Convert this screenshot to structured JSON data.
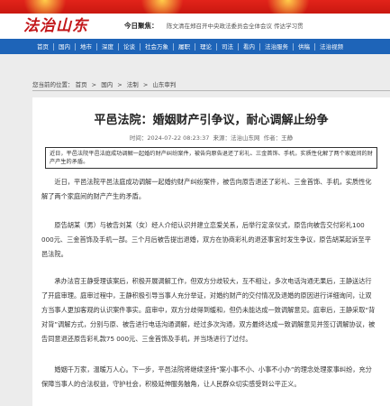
{
  "header": {
    "logo_text": "法治山东",
    "focus_label": "今日聚焦：",
    "focus_text": "陈文清在郑召开中央政法委员会全体会议 传达学习贯"
  },
  "nav": {
    "items": [
      "首页",
      "国内",
      "地市",
      "深度",
      "论谈",
      "社会万象",
      "履职",
      "理论",
      "司法",
      "看内",
      "法治服务",
      "供稿",
      "法治视频"
    ]
  },
  "breadcrumb": {
    "prefix": "您当前的位置：",
    "items": [
      "首页",
      "国内",
      "法制",
      "山东审判"
    ]
  },
  "article": {
    "title": "平邑法院：婚姻财产引争议，耐心调解止纷争",
    "time_label": "时间：",
    "time": "2024-07-22 08:23:37",
    "source_label": "来源：",
    "source": "法治山东网",
    "author_label": "作者：",
    "author": "王静",
    "summary": "近日，平邑法院平邑法庭成功调解一起婚约财产纠纷案件，被告向原告退还了彩礼、三金首饰、手机，实质性化解了两个家庭间的财产产生的矛盾。",
    "paragraphs": [
      "近日，平邑法院平邑法庭成功调解一起婚约财产纠纷案件，被告向原告退还了彩礼、三金首饰、手机，实质性化解了两个家庭间的财产产生的矛盾。",
      "原告胡某（男）与被告刘某（女）经人介绍认识并建立恋爱关系，后举行定亲仪式，原告向被告交付彩礼100 000元、三金首饰及手机一部。三个月后被告提出退婚，双方在协商彩礼的退还事宜时发生争议，原告胡某起诉至平邑法院。",
      "承办法官王静受理该案后，积极开展调解工作，但双方分歧较大，互不相让，多次电话沟通无果后，王静送达行了开庭审理。庭审过程中，王静积极引导当事人充分举证，对婚约财产的交付情况及退婚的原因进行详细询问，让双方当事人更加客观的认识案件事实。庭审中，双方分歧得到缓和，但仍未能达成一致调解意见。庭审后，王静采取“背对背”调解方式，分别与原、被告进行电话沟通调解，经过多次沟通，双方最终达成一致调解意见并签订调解协议，被告同意退还原告彩礼款75 000元、三金首饰及手机，并当场进行了过付。",
      "婚姻千万家，温暖万人心。下一步，平邑法院将继续坚持“案小事不小、小事不小办”的理念处理家事纠纷，充分保障当事人的合法权益，守护社会，积极延伸服务触角，让人民群众切实感受到公平正义。"
    ]
  }
}
